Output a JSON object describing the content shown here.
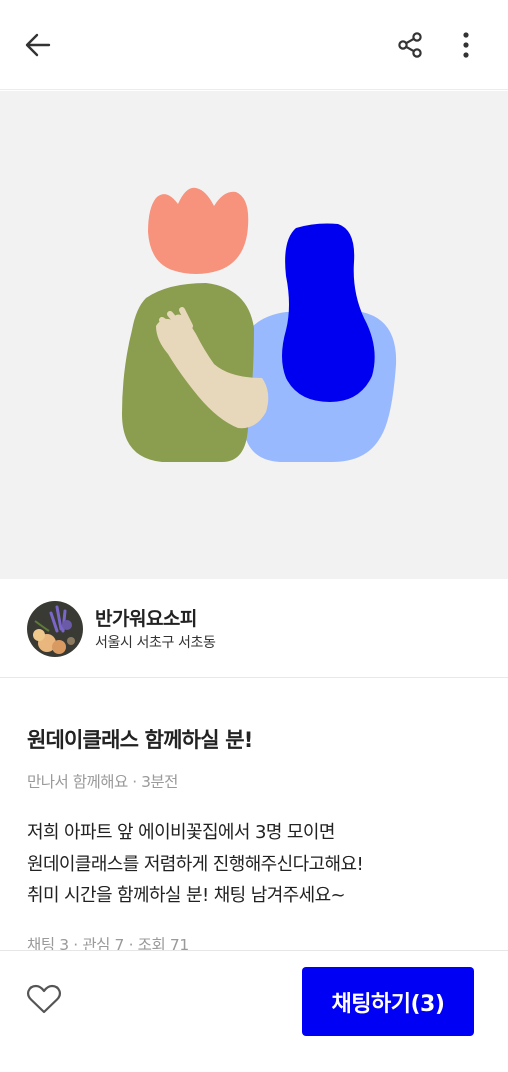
{
  "appbar": {
    "back_icon": "arrow-left-icon",
    "share_icon": "share-icon",
    "more_icon": "more-vertical-icon"
  },
  "hero": {
    "illustration": "two-people-hugging-illustration"
  },
  "author": {
    "avatar_icon": "flower-avatar",
    "nickname": "반가워요소피",
    "location": "서울시 서초구 서초동"
  },
  "post": {
    "title": "원데이클래스 함께하실 분!",
    "category": "만나서 함께해요",
    "separator": "·",
    "time_ago": "3분전",
    "body_lines": [
      "저희 아파트 앞 에이비꽃집에서 3명 모이면",
      "원데이클래스를 저렴하게 진행해주신다고해요!",
      "취미 시간을 함께하실 분! 채팅 남겨주세요~"
    ],
    "stats": {
      "chat_label": "채팅 3",
      "interest_label": "관심 7",
      "view_label": "조회 71"
    }
  },
  "bottom": {
    "like_icon": "heart-outline-icon",
    "chat_button_label": "채팅하기(3)"
  },
  "colors": {
    "accent": "#0000f5",
    "hero_background": "#f2f2f2",
    "person_left_head": "#f7927d",
    "person_left_body": "#8b9d4f",
    "person_right_hair": "#0000f0",
    "person_right_body": "#99b9ff",
    "arm": "#e8d8bb"
  }
}
